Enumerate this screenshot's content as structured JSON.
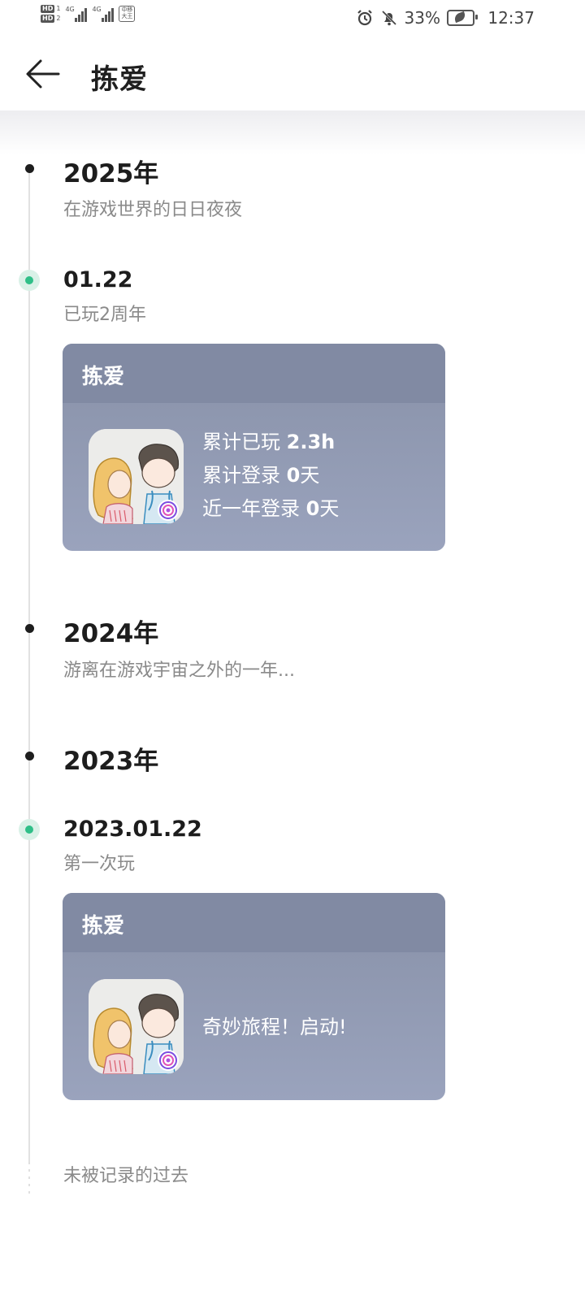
{
  "status_bar": {
    "battery_percent": "33%",
    "time": "12:37",
    "hd1": "1",
    "hd2": "2",
    "network": "4G",
    "carrier_logo": "中移大王",
    "icons": [
      "alarm-icon",
      "bell-off-icon",
      "battery-saver-icon"
    ]
  },
  "header": {
    "title": "拣爱",
    "back_icon": "arrow-left-icon"
  },
  "timeline": {
    "year_2025": {
      "year": "2025年",
      "subtitle": "在游戏世界的日日夜夜"
    },
    "entry_0122": {
      "date": "01.22",
      "note": "已玩2周年",
      "card": {
        "game_name": "拣爱",
        "stats": [
          {
            "label": "累计已玩 ",
            "value": "2.3h",
            "suffix": ""
          },
          {
            "label": "累计登录 ",
            "value": "0",
            "suffix": "天"
          },
          {
            "label": "近一年登录 ",
            "value": "0",
            "suffix": "天"
          }
        ]
      }
    },
    "year_2024": {
      "year": "2024年",
      "subtitle": "游离在游戏宇宙之外的一年..."
    },
    "year_2023": {
      "year": "2023年"
    },
    "entry_20230122": {
      "date": "2023.01.22",
      "note": "第一次玩",
      "card": {
        "game_name": "拣爱",
        "message": "奇妙旅程！启动!"
      }
    },
    "end_label": "未被记录的过去"
  }
}
